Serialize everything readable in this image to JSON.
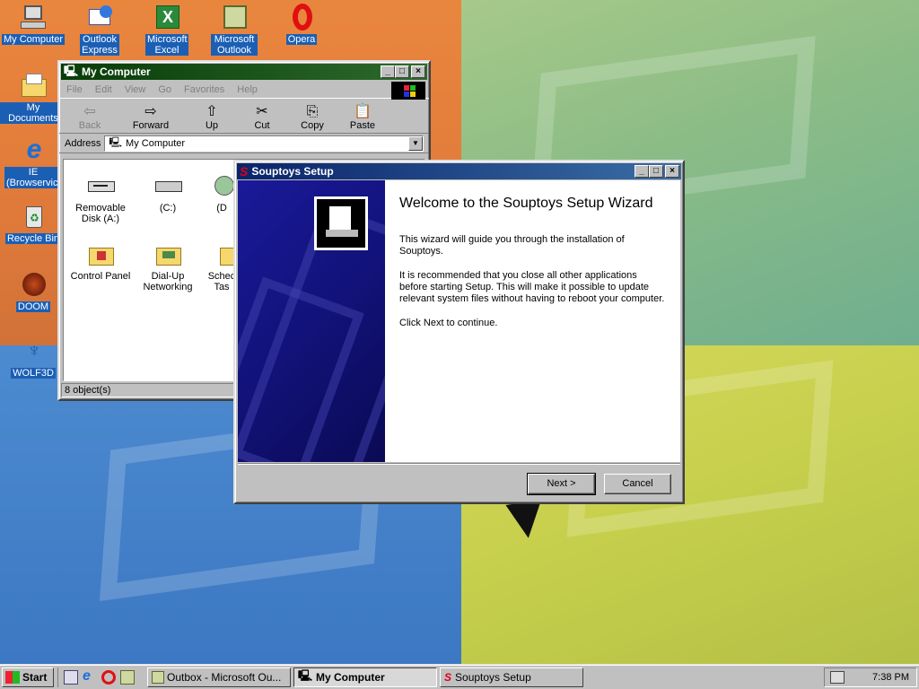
{
  "desktop": {
    "icons": [
      {
        "label": "My Computer",
        "icon": "my-computer-icon"
      },
      {
        "label": "Outlook Express",
        "icon": "outlook-express-icon"
      },
      {
        "label": "Microsoft Excel",
        "icon": "excel-icon"
      },
      {
        "label": "Microsoft Outlook",
        "icon": "outlook-icon"
      },
      {
        "label": "Opera",
        "icon": "opera-icon"
      },
      {
        "label": "My Documents",
        "icon": "folder-icon"
      },
      {
        "label": "IE (Browservice)",
        "icon": "internet-explorer-icon"
      },
      {
        "label": "Recycle Bin",
        "icon": "recycle-bin-icon"
      },
      {
        "label": "DOOM",
        "icon": "doom-icon"
      },
      {
        "label": "WOLF3D",
        "icon": "wolf3d-icon"
      }
    ]
  },
  "mycomputer": {
    "title": "My Computer",
    "menu": [
      "File",
      "Edit",
      "View",
      "Go",
      "Favorites",
      "Help"
    ],
    "toolbar": [
      {
        "label": "Back",
        "glyph": "⇦",
        "enabled": false
      },
      {
        "label": "Forward",
        "glyph": "⇨",
        "enabled": true
      },
      {
        "label": "Up",
        "glyph": "⇧",
        "enabled": true
      },
      {
        "label": "Cut",
        "glyph": "✂",
        "enabled": true
      },
      {
        "label": "Copy",
        "glyph": "⎘",
        "enabled": true
      },
      {
        "label": "Paste",
        "glyph": "📋",
        "enabled": true
      }
    ],
    "address_label": "Address",
    "address_value": "My Computer",
    "items": [
      {
        "label": "Removable Disk (A:)",
        "icon": "floppy-drive-icon"
      },
      {
        "label": "(C:)",
        "icon": "hard-drive-icon"
      },
      {
        "label": "(D",
        "icon": "cd-drive-icon"
      },
      {
        "label": "Control Panel",
        "icon": "control-panel-icon"
      },
      {
        "label": "Dial-Up Networking",
        "icon": "dialup-icon"
      },
      {
        "label": "Schec Tas",
        "icon": "scheduled-tasks-icon"
      }
    ],
    "status": "8 object(s)"
  },
  "setup": {
    "title": "Souptoys Setup",
    "heading": "Welcome to the Souptoys Setup Wizard",
    "para1": "This wizard will guide you through the installation of Souptoys.",
    "para2": "It is recommended that you close all other applications before starting Setup. This will make it possible to update relevant system files without having to reboot your computer.",
    "para3": "Click Next to continue.",
    "next": "Next >",
    "cancel": "Cancel"
  },
  "taskbar": {
    "start": "Start",
    "tasks": [
      {
        "label": "Outbox - Microsoft Ou...",
        "active": false
      },
      {
        "label": "My Computer",
        "active": true
      },
      {
        "label": "Souptoys Setup",
        "active": false
      }
    ],
    "clock": "7:38 PM"
  },
  "colors": {
    "active_title": "#0a246a",
    "inactive_title": "#083c08",
    "face": "#c0c0c0",
    "souptoys_red": "#e0001a"
  }
}
